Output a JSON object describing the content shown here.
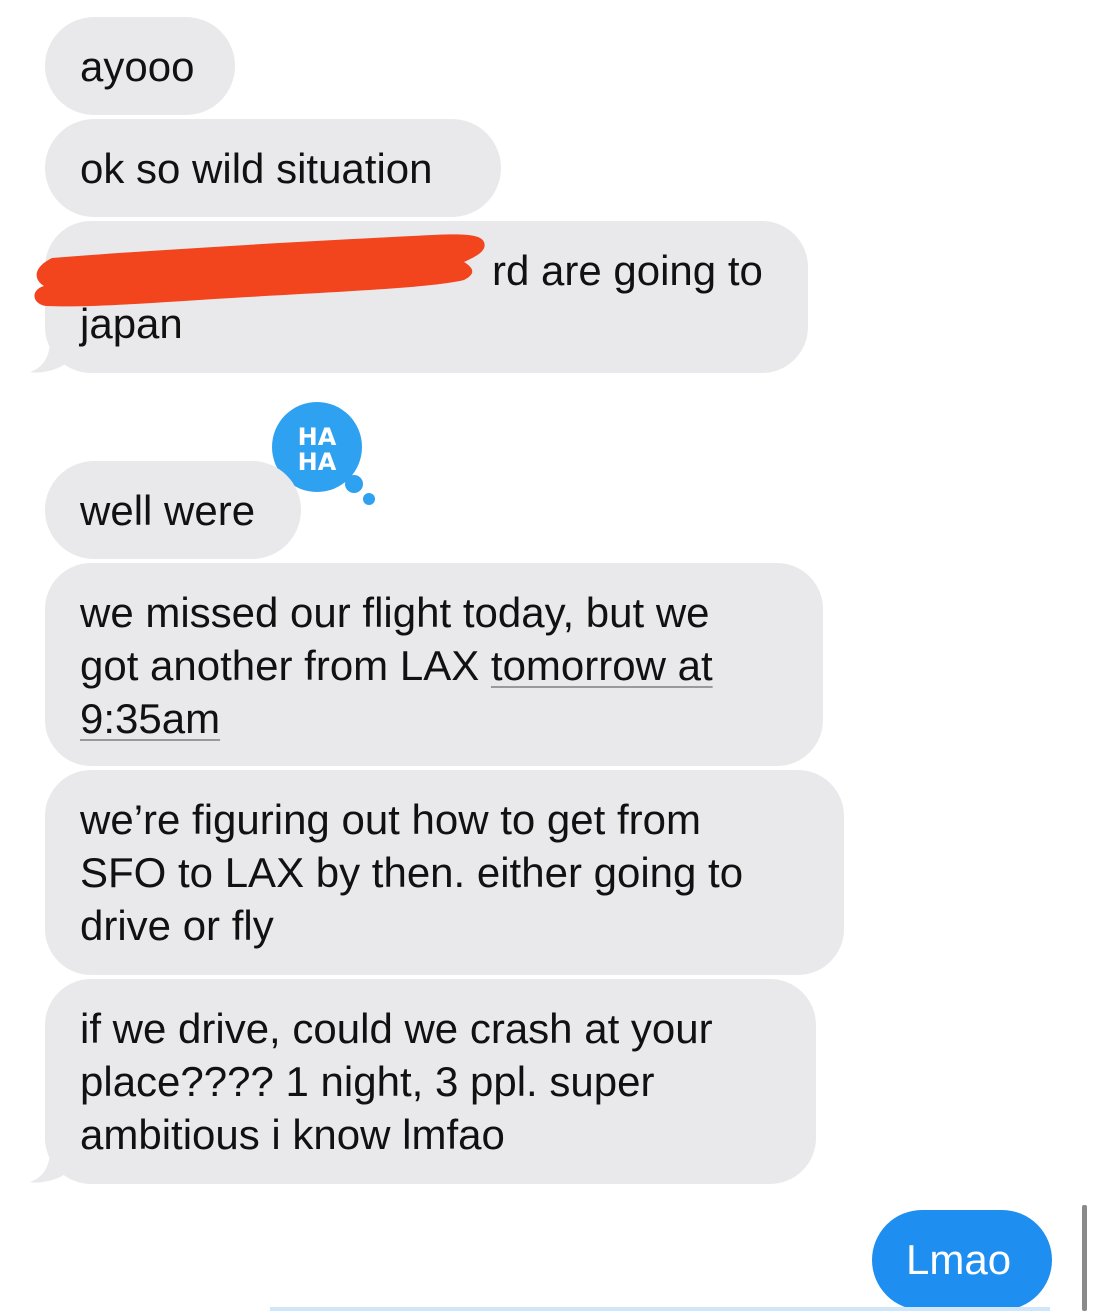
{
  "conversation": {
    "incoming": [
      {
        "text": "ayooo"
      },
      {
        "text": "ok so wild situation"
      },
      {
        "line1": "rd are going to",
        "line2": "japan",
        "redacted": true,
        "redaction_color": "#f2441d"
      },
      {
        "text": "well were",
        "reaction": {
          "icon": "haha-reaction-icon",
          "label_top": "HA",
          "label_bottom": "HA",
          "color": "#2fa1f1"
        }
      },
      {
        "line1": "we missed our flight today, but we",
        "line2_pre": "got another from LAX ",
        "line2_link": "tomorrow at",
        "line3_link": "9:35am"
      },
      {
        "line1": "we’re figuring out how to get from",
        "line2": "SFO to LAX by then. either going to",
        "line3": "drive or fly"
      },
      {
        "line1": "if we drive, could we crash at your",
        "line2": "place???? 1 night, 3 ppl. super",
        "line3": "ambitious i know lmfao"
      }
    ],
    "outgoing": [
      {
        "text": "Lmao",
        "color": "#1f8ef1"
      }
    ],
    "incoming_bubble_color": "#e9e9eb"
  }
}
